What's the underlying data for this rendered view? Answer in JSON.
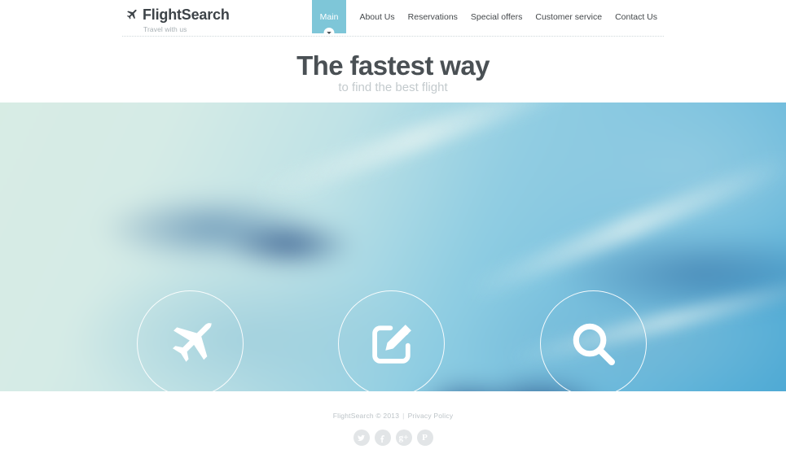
{
  "site": {
    "logo_title": "FlightSearch",
    "logo_tagline": "Travel with us",
    "logo_icon": "airplane-icon"
  },
  "nav": {
    "items": [
      {
        "label": "Main",
        "active": true,
        "badge_icon": "chevron-down-icon"
      },
      {
        "label": "About Us",
        "active": false
      },
      {
        "label": "Reservations",
        "active": false
      },
      {
        "label": "Special offers",
        "active": false
      },
      {
        "label": "Customer service",
        "active": false
      },
      {
        "label": "Contact Us",
        "active": false
      }
    ],
    "active_bg": "#7ec6d8"
  },
  "hero": {
    "headline": "The fastest way",
    "subheadline": "to find the best flight",
    "headline_color": "#4a5054",
    "subheadline_color": "#c3cacd",
    "buttons": [
      {
        "icon": "airplane-icon",
        "name": "hero-circle-flights"
      },
      {
        "icon": "edit-pencil-icon",
        "name": "hero-circle-book"
      },
      {
        "icon": "search-icon",
        "name": "hero-circle-search"
      }
    ]
  },
  "footer": {
    "copyright": "FlightSearch © 2013",
    "separator": "|",
    "privacy_label": "Privacy Policy",
    "socials": [
      {
        "name": "twitter-icon",
        "glyph": "t"
      },
      {
        "name": "facebook-icon",
        "glyph": "f"
      },
      {
        "name": "google-plus-icon",
        "glyph": "g+"
      },
      {
        "name": "pinterest-icon",
        "glyph": "P"
      }
    ],
    "social_bg": "#e2e5e7"
  }
}
